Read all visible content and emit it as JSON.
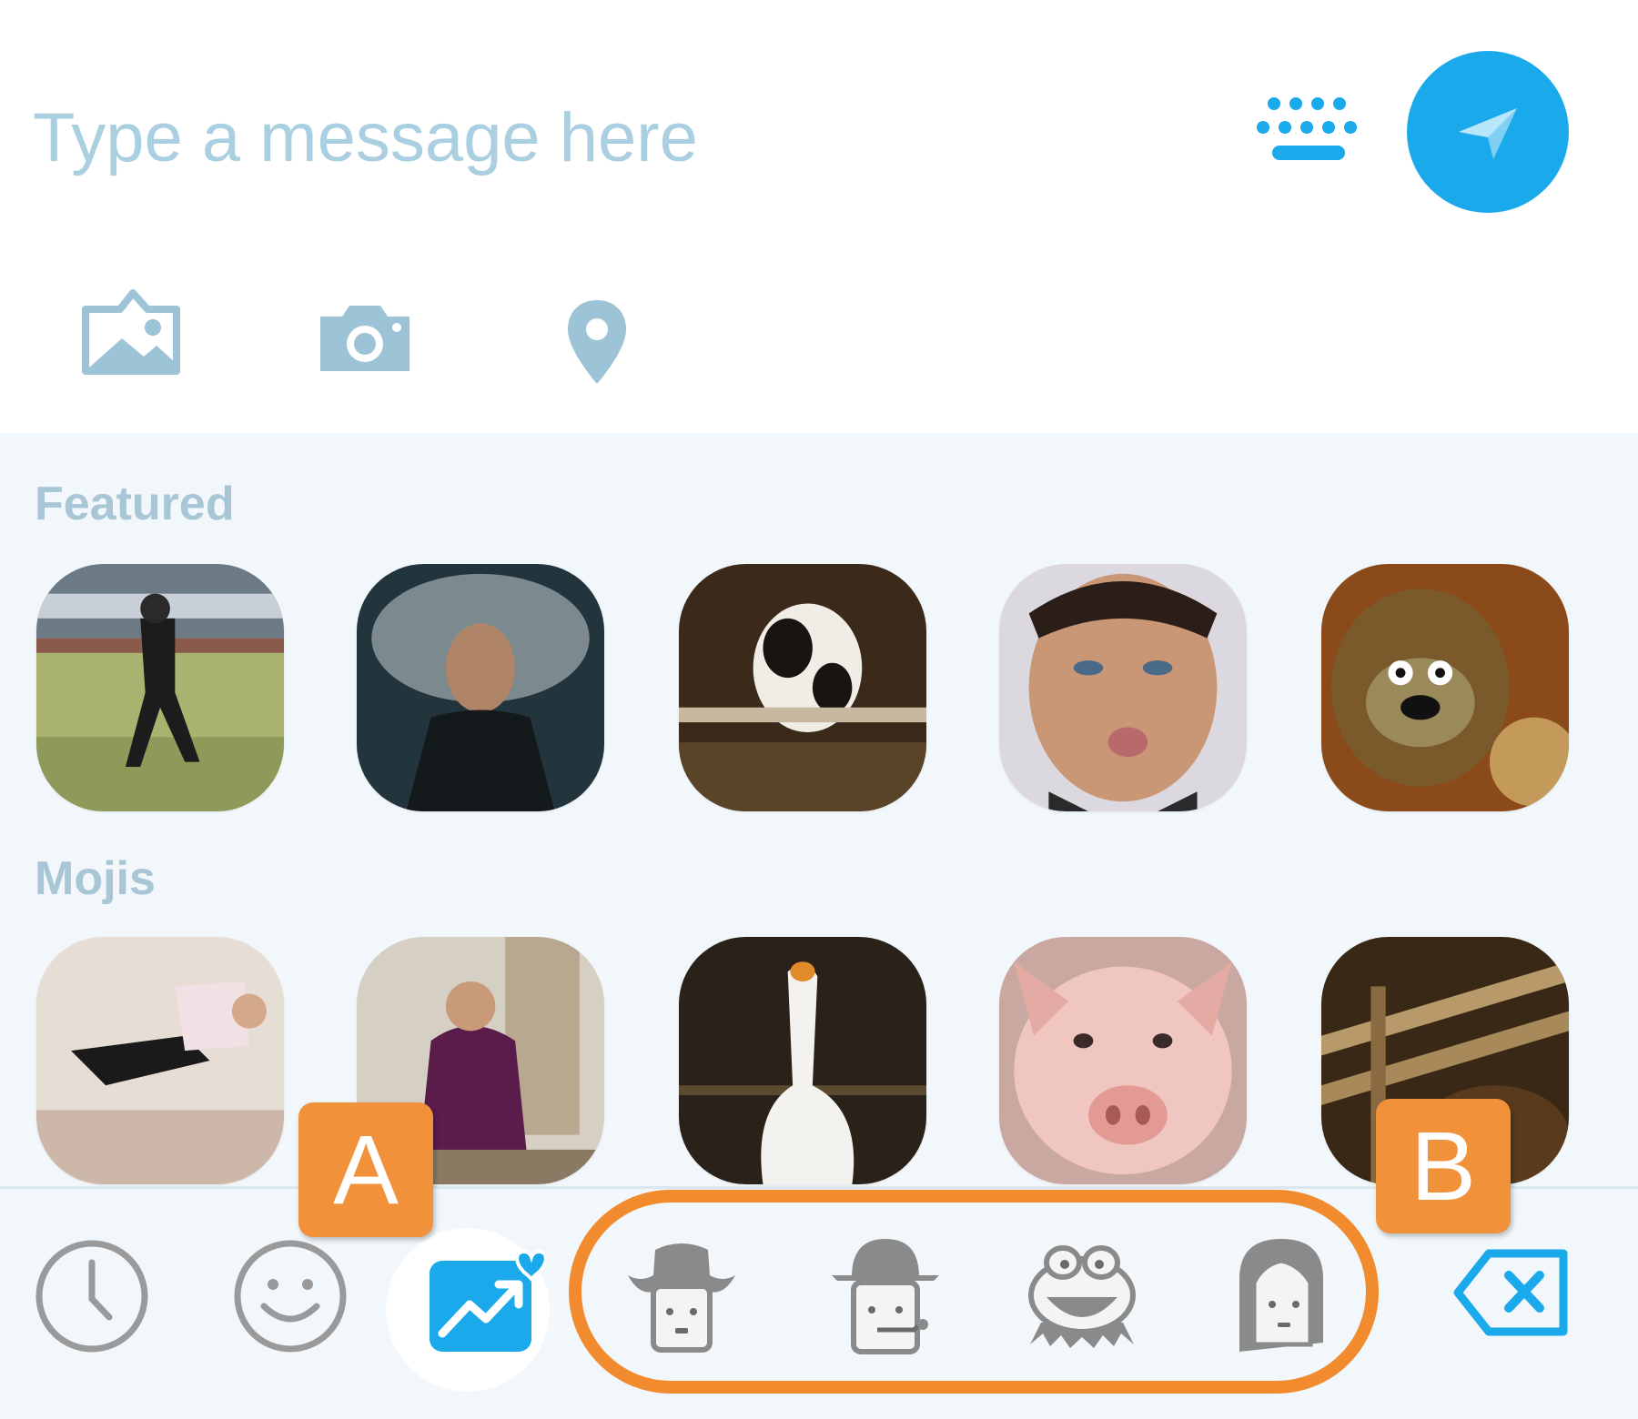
{
  "compose": {
    "placeholder": "Type a message here",
    "value": "",
    "accent_color": "#1aa9ea"
  },
  "attachments": [
    {
      "icon": "image-icon"
    },
    {
      "icon": "camera-icon"
    },
    {
      "icon": "location-pin-icon"
    }
  ],
  "panel": {
    "sections": [
      {
        "label": "Featured"
      },
      {
        "label": "Mojis"
      }
    ]
  },
  "toolbar": {
    "items": [
      {
        "icon": "recent-clock-icon"
      },
      {
        "icon": "smiley-icon"
      },
      {
        "icon": "trending-mojis-icon",
        "selected": true
      },
      {
        "icon": "cowboy-moji-icon"
      },
      {
        "icon": "bowler-hat-moji-icon"
      },
      {
        "icon": "kermit-frog-moji-icon"
      },
      {
        "icon": "woman-moji-icon"
      },
      {
        "icon": "backspace-icon"
      }
    ]
  },
  "annotations": {
    "callout_a": "A",
    "callout_b": "B",
    "highlight_color": "#f28a2e"
  }
}
